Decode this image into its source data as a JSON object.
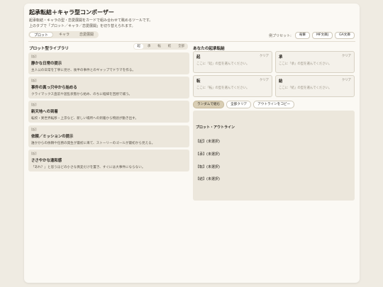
{
  "header": {
    "title": "起承転結＋キャラ型コンポーザー",
    "desc1": "起承転結・キャラの型・恋愛展開をカードで組み合わせて眺めるツールです。",
    "desc2": "上のタブで「プロット／キャラ／恋愛展開」を切り替えられます。"
  },
  "tabs": [
    "プロット",
    "キャラ",
    "恋愛展開"
  ],
  "presets": {
    "label": "例プリセット:",
    "items": [
      "竜撃",
      "MF文庫J",
      "GA文庫"
    ]
  },
  "library": {
    "title": "プロット型ライブラリ",
    "filters": [
      "起",
      "承",
      "転",
      "結",
      "全部"
    ],
    "items": [
      {
        "tag": "[起]",
        "title": "静かな日常の提示",
        "desc": "主人公の日常を丁寧に見せ、後半の事件とのギャップでドラマを作る。"
      },
      {
        "tag": "[起]",
        "title": "事件の真っ只中から始める",
        "desc": "クライマックス直前や混乱状態から始め、のちに経緯を回想で補う。"
      },
      {
        "tag": "[起]",
        "title": "新天地への到着",
        "desc": "転校・異世界転移・上京など、新しい場所への到着から物語が動き出す。"
      },
      {
        "tag": "[起]",
        "title": "依頼／ミッションの提示",
        "desc": "誰かからの依頼や任務の発生が最初に来て、ストーリーのゴールが最初から見える。"
      },
      {
        "tag": "[起]",
        "title": "ささやかな違和感",
        "desc": "「あれ？」と思うほどの小さな異変だけを置き、すぐには大事件にならない。"
      }
    ]
  },
  "slots": {
    "title": "あなたの起承転結",
    "clear_label": "クリア",
    "hint": "ここに「起」の型を選んでください。",
    "items": [
      {
        "label": "起",
        "hint": "ここに「起」の型を選んでください。"
      },
      {
        "label": "承",
        "hint": "ここに「承」の型を選んでください。"
      },
      {
        "label": "転",
        "hint": "ここに「転」の型を選んでください。"
      },
      {
        "label": "結",
        "hint": "ここに「結」の型を選んでください。"
      }
    ]
  },
  "actions": {
    "random": "ランダムで組む",
    "clear_all": "全部クリア",
    "copy": "アウトラインをコピー"
  },
  "outline": {
    "heading": "プロット・アウトライン",
    "lines": [
      "【起】(未選択)",
      "【承】(未選択)",
      "【転】(未選択)",
      "【結】(未選択)"
    ]
  }
}
